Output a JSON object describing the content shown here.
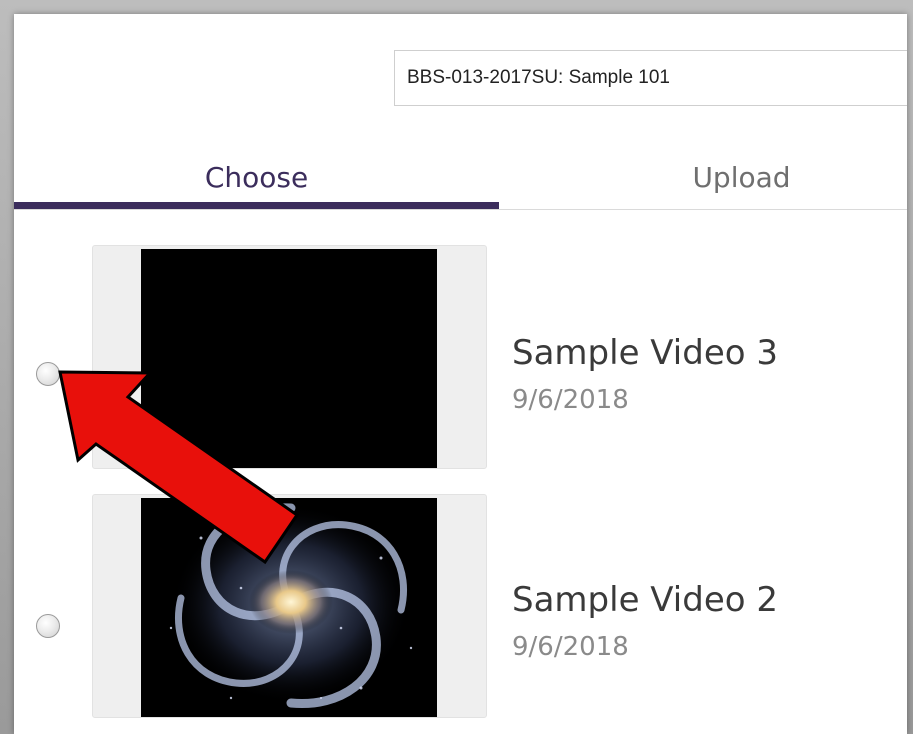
{
  "header": {
    "course_value": "BBS-013-2017SU: Sample 101"
  },
  "tabs": [
    {
      "label": "Choose",
      "active": true
    },
    {
      "label": "Upload",
      "active": false
    }
  ],
  "videos": [
    {
      "title": "Sample Video 3",
      "date": "9/6/2018",
      "thumbnail": "black-frame"
    },
    {
      "title": "Sample Video 2",
      "date": "9/6/2018",
      "thumbnail": "spiral-galaxy"
    }
  ],
  "annotation": {
    "icon": "red-arrow-icon",
    "color": "#e8100b"
  },
  "colors": {
    "accent": "#3b2d5c",
    "arrow": "#e8100b"
  }
}
